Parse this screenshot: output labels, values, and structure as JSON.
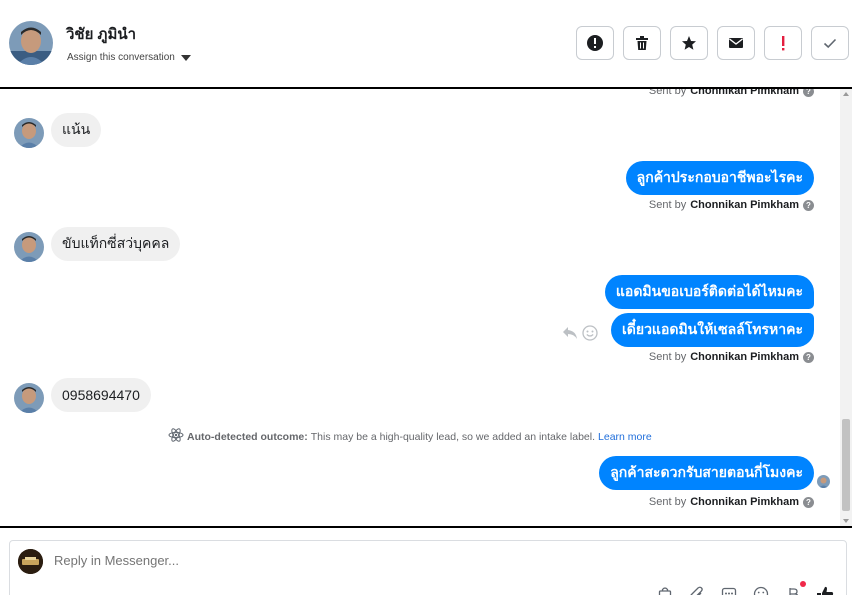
{
  "header": {
    "contact_name": "วิชัย ภูมินำ",
    "assign_label": "Assign this conversation",
    "actions": [
      "alert-circle-icon",
      "trash-icon",
      "star-icon",
      "mail-icon",
      "exclamation-icon",
      "check-icon"
    ]
  },
  "thread": {
    "sent_by_prefix": "Sent by",
    "agent_name": "Chonnikan Pimkham",
    "messages": [
      {
        "direction": "in",
        "text": "แน้น"
      },
      {
        "direction": "out",
        "text": "ลูกค้าประกอบอาชีพอะไรคะ"
      },
      {
        "direction": "in",
        "text": "ขับแท็กซี่สว่บุคคล"
      },
      {
        "direction": "out",
        "text": "แอดมินขอเบอร์ติดต่อได้ไหมคะ"
      },
      {
        "direction": "out",
        "text": "เดี๋ยวแอดมินให้เซลล์โทรหาคะ"
      },
      {
        "direction": "in",
        "text": "0958694470"
      },
      {
        "direction": "out",
        "text": "ลูกค้าสะดวกรับสายตอนกี่โมงคะ"
      }
    ],
    "outcome": {
      "label": "Auto-detected outcome:",
      "text": "This may be a high-quality lead, so we added an intake label.",
      "link": "Learn more"
    }
  },
  "composer": {
    "placeholder": "Reply in Messenger..."
  },
  "colors": {
    "outgoing_bubble": "#0084ff",
    "incoming_bubble": "#f0f0f0",
    "link": "#216fdb",
    "alert_red": "#e41e3f"
  }
}
